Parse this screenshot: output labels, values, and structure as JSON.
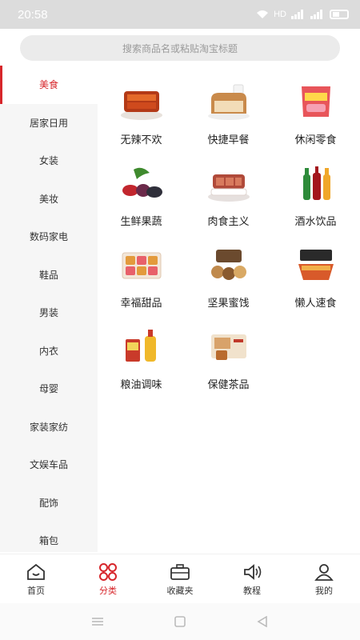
{
  "status_bar": {
    "time": "20:58",
    "net_label": "HD"
  },
  "search": {
    "placeholder": "搜索商品名或粘贴淘宝标题"
  },
  "sidebar": {
    "items": [
      {
        "label": "美食",
        "active": true
      },
      {
        "label": "居家日用"
      },
      {
        "label": "女装"
      },
      {
        "label": "美妆"
      },
      {
        "label": "数码家电"
      },
      {
        "label": "鞋品"
      },
      {
        "label": "男装"
      },
      {
        "label": "内衣"
      },
      {
        "label": "母婴"
      },
      {
        "label": "家装家纺"
      },
      {
        "label": "文娱车品"
      },
      {
        "label": "配饰"
      },
      {
        "label": "箱包"
      }
    ]
  },
  "categories": [
    {
      "label": "无辣不欢",
      "icon": "spicy-food-icon"
    },
    {
      "label": "快捷早餐",
      "icon": "bread-icon"
    },
    {
      "label": "休闲零食",
      "icon": "snack-bag-icon"
    },
    {
      "label": "生鲜果蔬",
      "icon": "fresh-produce-icon"
    },
    {
      "label": "肉食主义",
      "icon": "meat-icon"
    },
    {
      "label": "酒水饮品",
      "icon": "bottles-icon"
    },
    {
      "label": "幸福甜品",
      "icon": "dessert-box-icon"
    },
    {
      "label": "坚果蜜饯",
      "icon": "nuts-icon"
    },
    {
      "label": "懒人速食",
      "icon": "instant-food-icon"
    },
    {
      "label": "粮油调味",
      "icon": "oil-bottle-icon"
    },
    {
      "label": "保健茶品",
      "icon": "tea-box-icon"
    }
  ],
  "tabbar": {
    "items": [
      {
        "label": "首页",
        "icon": "home-icon"
      },
      {
        "label": "分类",
        "icon": "category-icon",
        "active": true
      },
      {
        "label": "收藏夹",
        "icon": "briefcase-icon"
      },
      {
        "label": "教程",
        "icon": "speaker-icon"
      },
      {
        "label": "我的",
        "icon": "user-icon"
      }
    ]
  },
  "colors": {
    "accent": "#d7262b",
    "sidebar_bg": "#f6f6f6",
    "search_bg": "#ebebeb"
  }
}
